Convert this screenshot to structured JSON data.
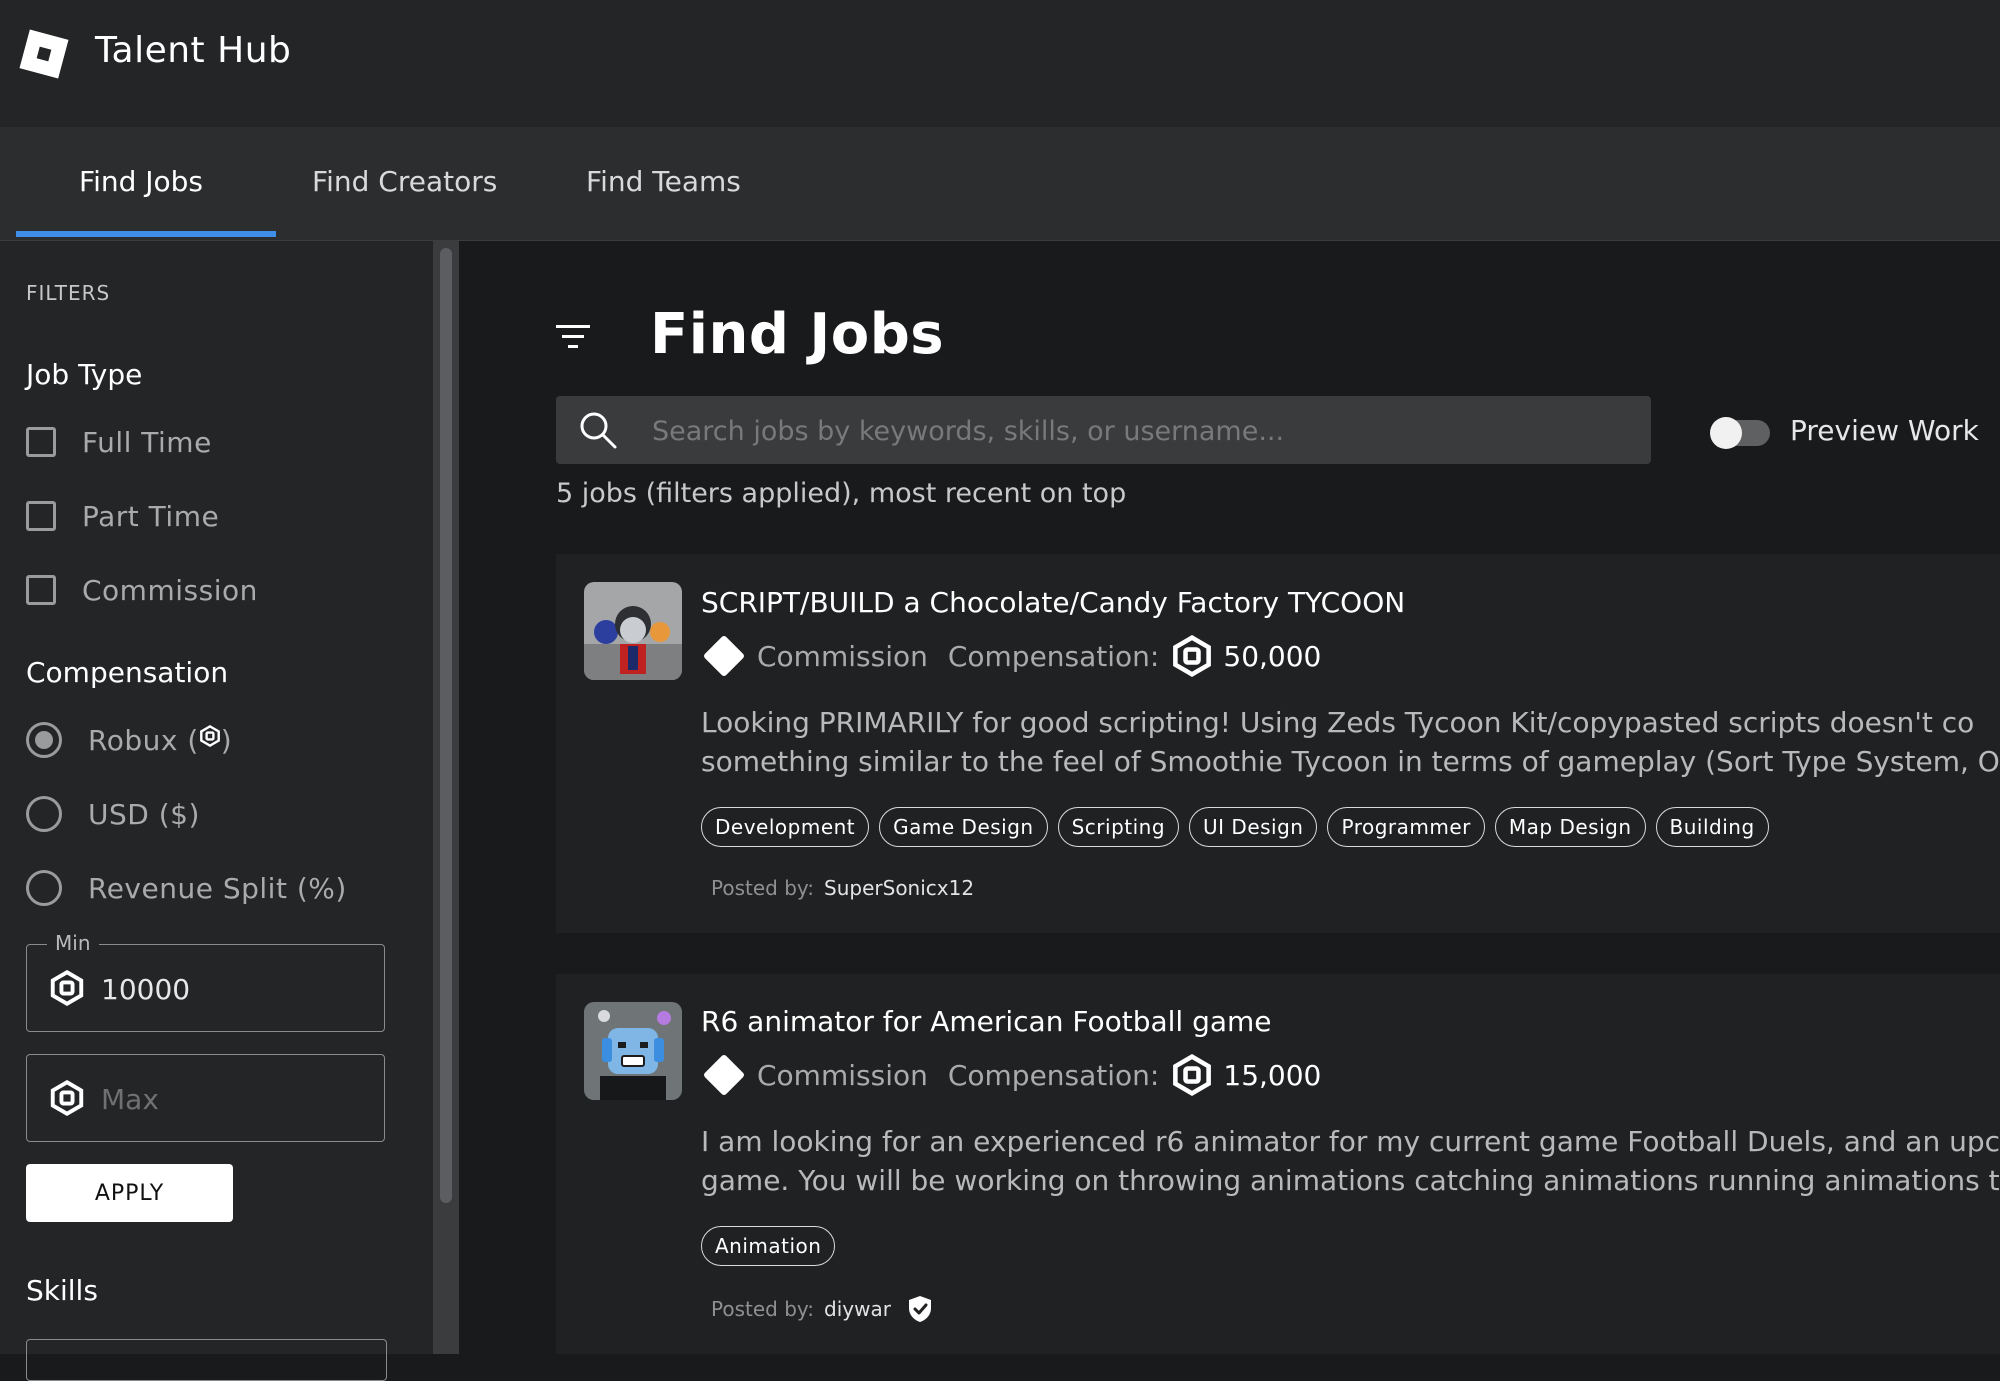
{
  "app": {
    "title": "Talent Hub"
  },
  "tabs": [
    {
      "label": "Find Jobs",
      "active": true
    },
    {
      "label": "Find Creators",
      "active": false
    },
    {
      "label": "Find Teams",
      "active": false
    }
  ],
  "sidebar": {
    "heading": "FILTERS",
    "job_type": {
      "title": "Job Type",
      "options": [
        {
          "label": "Full Time",
          "checked": false
        },
        {
          "label": "Part Time",
          "checked": false
        },
        {
          "label": "Commission",
          "checked": false
        }
      ]
    },
    "compensation": {
      "title": "Compensation",
      "options": [
        {
          "label_prefix": "Robux (",
          "label_suffix": ")",
          "selected": true,
          "icon": "robux-icon"
        },
        {
          "label": "USD ($)",
          "selected": false
        },
        {
          "label": "Revenue Split (%)",
          "selected": false
        }
      ],
      "min_legend": "Min",
      "min_value": "10000",
      "max_placeholder": "Max",
      "apply_label": "APPLY"
    },
    "skills": {
      "title": "Skills"
    }
  },
  "main": {
    "title": "Find Jobs",
    "search_placeholder": "Search jobs by keywords, skills, or username...",
    "preview_label": "Preview Work",
    "preview_on": false,
    "result_count": "5 jobs (filters applied), most recent on top"
  },
  "jobs": [
    {
      "title": "SCRIPT/BUILD a Chocolate/Candy Factory TYCOON",
      "type": "Commission",
      "compensation_label": "Compensation:",
      "amount": "50,000",
      "desc_line1": "Looking PRIMARILY for good scripting! Using Zeds Tycoon Kit/copypasted scripts doesn't co",
      "desc_line2": "something similar to the feel of Smoothie Tycoon in terms of gameplay (Sort Type System, O",
      "tags": [
        "Development",
        "Game Design",
        "Scripting",
        "UI Design",
        "Programmer",
        "Map Design",
        "Building"
      ],
      "posted_label": "Posted by:",
      "poster": "SuperSonicx12",
      "verified": false
    },
    {
      "title": "R6 animator for American Football game",
      "type": "Commission",
      "compensation_label": "Compensation:",
      "amount": "15,000",
      "desc_line1": "I am looking for an experienced r6 animator for my current game Football Duels, and an upco",
      "desc_line2": "game. You will be working on throwing animations catching animations running animations ta",
      "tags": [
        "Animation"
      ],
      "posted_label": "Posted by:",
      "poster": "diywar",
      "verified": true
    }
  ],
  "colors": {
    "accent": "#3f8fe8",
    "background": "#191a1b",
    "header": "#232527",
    "card": "#202122"
  }
}
